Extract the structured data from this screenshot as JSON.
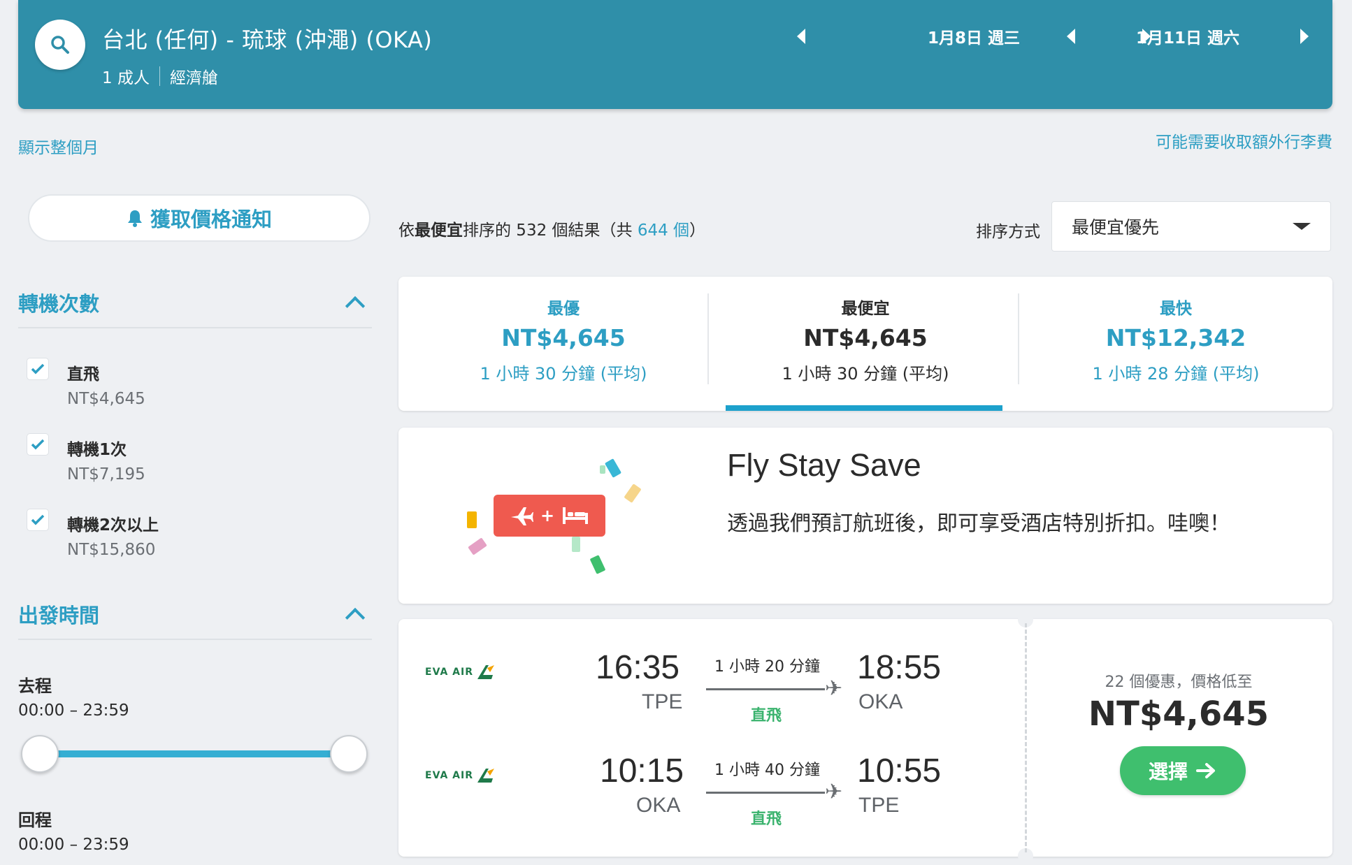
{
  "header": {
    "route": "台北 (任何) - 琉球 (沖澠) (OKA)",
    "passengers": "1 成人",
    "cabin": "經濟艙",
    "depart_date": "1月8日 週三",
    "return_date": "1月11日 週六"
  },
  "links": {
    "show_month": "顯示整個月",
    "baggage_fee": "可能需要收取額外行李費"
  },
  "sidebar": {
    "price_alert": "獲取價格通知",
    "stops": {
      "title": "轉機次數",
      "items": [
        {
          "label": "直飛",
          "price": "NT$4,645",
          "checked": true
        },
        {
          "label": "轉機1次",
          "price": "NT$7,195",
          "checked": true
        },
        {
          "label": "轉機2次以上",
          "price": "NT$15,860",
          "checked": true
        }
      ]
    },
    "departure_time": {
      "title": "出發時間",
      "outbound_label": "去程",
      "outbound_range": "00:00 – 23:59",
      "return_label": "回程",
      "return_range": "00:00 – 23:59"
    }
  },
  "results": {
    "prefix": "依",
    "sort_bold": "最便宜",
    "middle": "排序的 532 個結果（共 ",
    "total": "644 個",
    "suffix": "）",
    "sort_label": "排序方式",
    "sort_value": "最便宜優先"
  },
  "tabs": [
    {
      "title": "最優",
      "price": "NT$4,645",
      "duration": "1 小時 30 分鐘 (平均)"
    },
    {
      "title": "最便宜",
      "price": "NT$4,645",
      "duration": "1 小時 30 分鐘 (平均)"
    },
    {
      "title": "最快",
      "price": "NT$12,342",
      "duration": "1 小時 28 分鐘 (平均)"
    }
  ],
  "promo": {
    "title": "Fly Stay Save",
    "text": "透過我們預訂航班後，即可享受酒店特別折扣。哇噢！",
    "badge_plus": "+"
  },
  "flight": {
    "legs": [
      {
        "airline": "EVA AIR",
        "dep_time": "16:35",
        "dep_airport": "TPE",
        "duration": "1 小時 20 分鐘",
        "stops": "直飛",
        "arr_time": "18:55",
        "arr_airport": "OKA"
      },
      {
        "airline": "EVA AIR",
        "dep_time": "10:15",
        "dep_airport": "OKA",
        "duration": "1 小時 40 分鐘",
        "stops": "直飛",
        "arr_time": "10:55",
        "arr_airport": "TPE"
      }
    ],
    "deals": "22 個優惠，價格低至",
    "price": "NT$4,645",
    "select": "選擇"
  },
  "colors": {
    "header_bg": "#2f8fa9",
    "accent": "#2d9ec3",
    "select_button": "#3fbf6e",
    "promo_badge": "#ef5a4f"
  }
}
